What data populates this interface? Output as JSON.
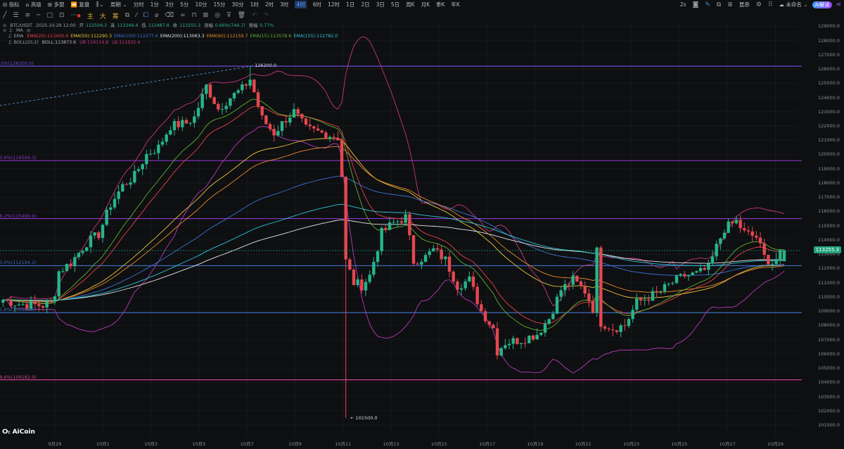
{
  "toolbar": {
    "left": [
      "指标",
      "高级",
      "多窗",
      "复盘"
    ],
    "period_label": "周期",
    "intervals": [
      "分时",
      "1分",
      "3分",
      "5分",
      "10分",
      "15分",
      "30分",
      "1时",
      "2时",
      "3时",
      "4时",
      "6时",
      "12时",
      "1日",
      "2日",
      "3日",
      "5日",
      "周K",
      "月K",
      "季K",
      "年K"
    ],
    "active_interval": "4时",
    "right": {
      "refresh": "2s",
      "display": "显示",
      "layout_name": "未命名",
      "ai_button": "AI解读"
    },
    "tools_text": [
      "主",
      "大",
      "筹"
    ]
  },
  "info": {
    "symbol": "BTC/USDT",
    "datetime": "2025-10-29 12:00",
    "open_label": "开",
    "open": "112509.3",
    "high_label": "高",
    "high": "113349.4",
    "low_label": "低",
    "low": "112487.8",
    "close_label": "收",
    "close": "113255.3",
    "change_label": "涨幅",
    "change": "0.66%(744.7)",
    "amplitude_label": "振幅",
    "amplitude": "0.77%",
    "ma_label": "MA",
    "ema_label": "EMA",
    "ema": [
      {
        "text": "EMA(20):113400.6",
        "period": 20,
        "color": "#e8414a"
      },
      {
        "text": "EMA(50):112290.3",
        "period": 50,
        "color": "#e8c53a"
      },
      {
        "text": "EMA(100):112277.6",
        "period": 100,
        "color": "#3b74d8"
      },
      {
        "text": "EMA(200):113063.3",
        "period": 200,
        "color": "#e6e6e6"
      },
      {
        "text": "EMA(60):112159.7",
        "period": 60,
        "color": "#e88a2a"
      },
      {
        "text": "EMA(15):113578.6",
        "period": 15,
        "color": "#5cb030"
      },
      {
        "text": "EMA(155):112782.0",
        "period": 155,
        "color": "#2ec4d6"
      }
    ],
    "boll_label": "BOLL(20,2)",
    "boll": {
      "mid": "BOLL:113873.6",
      "ub": "UB:116114.8",
      "lb": "LB:111632.4",
      "mid_color": "#bbbbbb",
      "ub_color": "#c8357e",
      "lb_color": "#b83ab8"
    }
  },
  "fib": [
    {
      "label": "0.0%(126200.0)",
      "price": 126200.0,
      "color": "#6a4cd8"
    },
    {
      "label": "23.6%(119569.3)",
      "price": 119569.3,
      "color": "#8a35c8"
    },
    {
      "label": "38.2%(115499.6)",
      "price": 115499.6,
      "color": "#8a35c8"
    },
    {
      "label": "50.0%(112194.2)",
      "price": 112194.2,
      "color": "#3a6ab8"
    },
    {
      "label": "61.8%(108888.8)",
      "price": 108888.8,
      "color": "#3a6ab8"
    },
    {
      "label": "78.6%(104182.9)",
      "price": 104182.9,
      "color": "#c8408a"
    }
  ],
  "annotations": {
    "high": "126200.0",
    "low": "101500.0"
  },
  "current_price": "113255.3",
  "y_axis": [
    "129000.0",
    "128000.0",
    "127000.0",
    "126000.0",
    "125000.0",
    "124000.0",
    "123000.0",
    "122000.0",
    "121000.0",
    "120000.0",
    "119000.0",
    "118000.0",
    "117000.0",
    "116000.0",
    "115000.0",
    "114000.0",
    "113000.0",
    "112000.0",
    "111000.0",
    "110000.0",
    "109000.0",
    "108000.0",
    "107000.0",
    "106000.0",
    "105000.0",
    "104000.0",
    "103000.0",
    "102000.0",
    "101000.0"
  ],
  "x_axis": [
    "9月29",
    "10月1",
    "10月3",
    "10月5",
    "10月7",
    "10月9",
    "10月11",
    "10月13",
    "10月15",
    "10月17",
    "10月19",
    "10月21",
    "10月23",
    "10月25",
    "10月27",
    "10月29"
  ],
  "logo": "AiCoin",
  "colors": {
    "up": "#26b58a",
    "down": "#e5474f",
    "bg": "#0e0f11"
  },
  "chart_data": {
    "type": "candlestick",
    "interval": "4h",
    "approx_close_path": [
      [
        "09-26 20",
        109800
      ],
      [
        "09-27 12",
        109500
      ],
      [
        "09-28 12",
        109400
      ],
      [
        "09-28 22",
        109600
      ],
      [
        "09-29 04",
        111800
      ],
      [
        "09-29 16",
        112400
      ],
      [
        "09-30 08",
        113800
      ],
      [
        "09-30 20",
        114400
      ],
      [
        "10-01 08",
        116500
      ],
      [
        "10-01 20",
        117800
      ],
      [
        "10-02 08",
        118500
      ],
      [
        "10-02 20",
        120000
      ],
      [
        "10-03 08",
        120500
      ],
      [
        "10-03 20",
        122000
      ],
      [
        "10-04 12",
        122200
      ],
      [
        "10-04 20",
        122600
      ],
      [
        "10-05 08",
        124800
      ],
      [
        "10-05 20",
        123200
      ],
      [
        "10-06 08",
        124000
      ],
      [
        "10-06 20",
        124600
      ],
      [
        "10-07 04",
        125300
      ],
      [
        "10-07 16",
        122500
      ],
      [
        "10-08 04",
        121500
      ],
      [
        "10-08 16",
        122500
      ],
      [
        "10-09 00",
        123000
      ],
      [
        "10-09 12",
        121800
      ],
      [
        "10-10 04",
        121500
      ],
      [
        "10-10 20",
        121200
      ],
      [
        "10-11 00",
        118500
      ],
      [
        "10-11 04",
        112500
      ],
      [
        "10-11 12",
        111000
      ],
      [
        "10-11 20",
        110800
      ],
      [
        "10-12 04",
        111500
      ],
      [
        "10-12 16",
        114500
      ],
      [
        "10-13 04",
        115200
      ],
      [
        "10-13 16",
        115600
      ],
      [
        "10-14 00",
        112500
      ],
      [
        "10-14 12",
        112800
      ],
      [
        "10-14 20",
        113300
      ],
      [
        "10-15 08",
        112600
      ],
      [
        "10-15 20",
        110800
      ],
      [
        "10-16 08",
        111200
      ],
      [
        "10-16 20",
        109000
      ],
      [
        "10-17 08",
        107800
      ],
      [
        "10-17 12",
        106200
      ],
      [
        "10-17 20",
        106800
      ],
      [
        "10-18 12",
        107000
      ],
      [
        "10-19 04",
        107400
      ],
      [
        "10-19 16",
        108500
      ],
      [
        "10-20 04",
        110500
      ],
      [
        "10-20 16",
        111200
      ],
      [
        "10-21 04",
        110400
      ],
      [
        "10-21 12",
        109200
      ],
      [
        "10-21 16",
        113200
      ],
      [
        "10-21 20",
        108200
      ],
      [
        "10-22 08",
        107800
      ],
      [
        "10-22 20",
        108000
      ],
      [
        "10-23 08",
        109600
      ],
      [
        "10-23 20",
        110000
      ],
      [
        "10-24 08",
        110400
      ],
      [
        "10-24 20",
        111000
      ],
      [
        "10-25 08",
        111500
      ],
      [
        "10-25 20",
        111600
      ],
      [
        "10-26 08",
        112000
      ],
      [
        "10-26 16",
        113500
      ],
      [
        "10-27 00",
        114800
      ],
      [
        "10-27 12",
        115300
      ],
      [
        "10-27 20",
        114500
      ],
      [
        "10-28 08",
        114200
      ],
      [
        "10-28 16",
        112800
      ],
      [
        "10-29 00",
        112400
      ],
      [
        "10-29 12",
        113255.3
      ]
    ],
    "high_point": {
      "time": "10-07 04",
      "price": 126200.0
    },
    "low_point": {
      "time": "10-11 04",
      "price": 101500.0
    },
    "last_candle": {
      "open": 112509.3,
      "high": 113349.4,
      "low": 112487.8,
      "close": 113255.3
    }
  }
}
